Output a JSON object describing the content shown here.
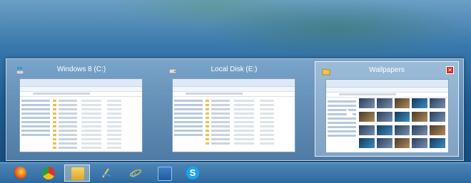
{
  "windows": [
    {
      "title": "Windows 8 (C:)",
      "icon": "drive-icon"
    },
    {
      "title": "Local Disk (E:)",
      "icon": "disk-icon"
    },
    {
      "title": "Wallpapers",
      "icon": "folder-icon",
      "selected": true
    }
  ],
  "close_label": "✕",
  "taskbar": {
    "apps": [
      "firefox-icon",
      "chrome-icon",
      "explorer-icon",
      "steam-icon",
      "ie-icon",
      "store-icon",
      "skype-icon"
    ],
    "active": "explorer-icon"
  },
  "colors": {
    "accent": "#3a79ad",
    "close": "#c8312a"
  }
}
